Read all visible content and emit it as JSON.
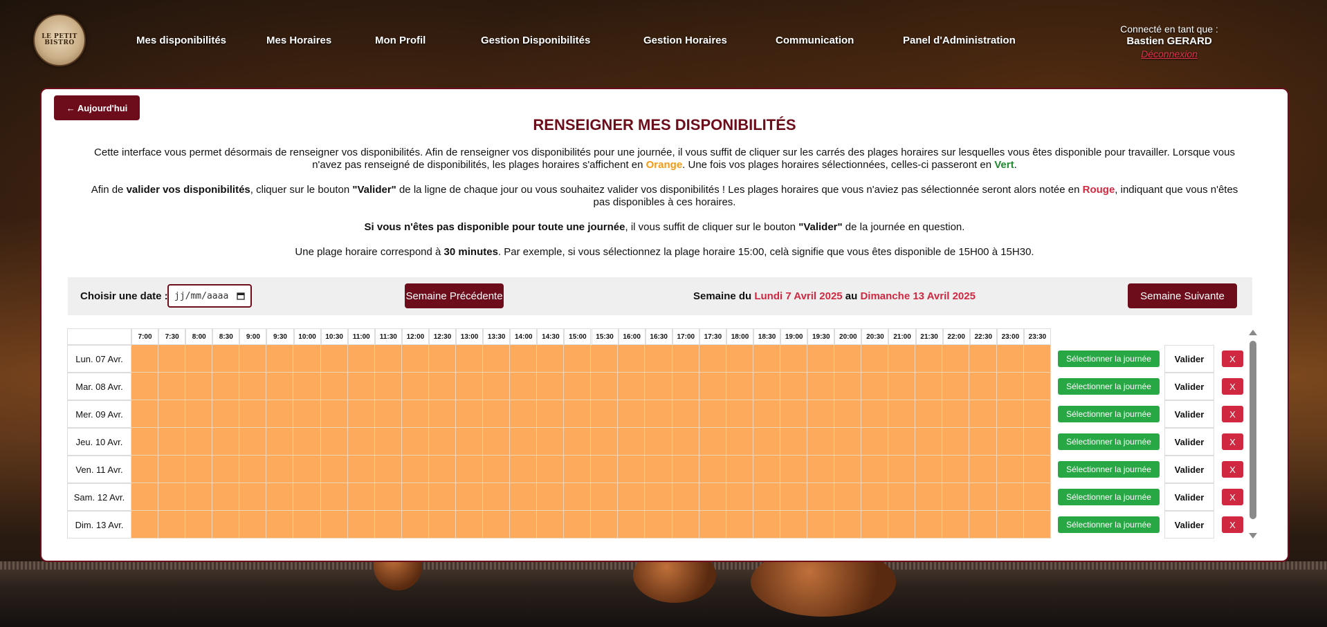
{
  "header": {
    "logo_text": "LE PETIT BISTRO",
    "nav": [
      {
        "label": "Mes disponibilités"
      },
      {
        "label": "Mes Horaires"
      },
      {
        "label": "Mon Profil"
      },
      {
        "label": "Gestion Disponibilités"
      },
      {
        "label": "Gestion Horaires"
      },
      {
        "label": "Communication"
      },
      {
        "label": "Panel d'Administration"
      }
    ],
    "user": {
      "connected_label": "Connecté en tant que :",
      "name": "Bastien GERARD",
      "logout": "Déconnexion"
    }
  },
  "main": {
    "today_button": "← Aujourd'hui",
    "title": "RENSEIGNER MES DISPONIBILITÉS",
    "para1": {
      "a": "Cette interface vous permet désormais de renseigner vos disponibilités. Afin de renseigner vos disponibilités pour une journée, il vous suffit de cliquer sur les carrés des plages horaires sur lesquelles vous êtes disponible pour travailler. Lorsque vous n'avez pas renseigné de disponibilités, les plages horaires s'affichent en ",
      "orange": "Orange",
      "b": ". Une fois vos plages horaires sélectionnées, celles-ci passeront en ",
      "green": "Vert",
      "c": "."
    },
    "para2": {
      "a": "Afin de ",
      "bold1": "valider vos disponibilités",
      "b": ", cliquer sur le bouton ",
      "bold2": "\"Valider\"",
      "c": " de la ligne de chaque jour ou vous souhaitez valider vos disponibilités ! Les plages horaires que vous n'aviez pas sélectionnée seront alors notée en ",
      "red": "Rouge",
      "d": ", indiquant que vous n'êtes pas disponibles à ces horaires."
    },
    "para3": {
      "bold1": "Si vous n'êtes pas disponible pour toute une journée",
      "a": ", il vous suffit de cliquer sur le bouton ",
      "bold2": "\"Valider\"",
      "b": " de la journée en question."
    },
    "para4": {
      "a": "Une plage horaire correspond à ",
      "bold1": "30 minutes",
      "b": ". Par exemple, si vous sélectionnez la plage horaire 15:00, celà signifie que vous êtes disponible de 15H00 à 15H30."
    },
    "week_nav": {
      "date_label": "Choisir une date :",
      "date_placeholder": "jj/mm/aaaa",
      "prev_button": "Semaine Précédente",
      "next_button": "Semaine Suivante",
      "week_prefix": "Semaine du ",
      "week_start": "Lundi 7 Avril 2025",
      "week_mid": " au ",
      "week_end": "Dimanche 13 Avril 2025"
    },
    "times": [
      "7:00",
      "7:30",
      "8:00",
      "8:30",
      "9:00",
      "9:30",
      "10:00",
      "10:30",
      "11:00",
      "11:30",
      "12:00",
      "12:30",
      "13:00",
      "13:30",
      "14:00",
      "14:30",
      "15:00",
      "15:30",
      "16:00",
      "16:30",
      "17:00",
      "17:30",
      "18:00",
      "18:30",
      "19:00",
      "19:30",
      "20:00",
      "20:30",
      "21:00",
      "21:30",
      "22:00",
      "22:30",
      "23:00",
      "23:30"
    ],
    "days": [
      {
        "label": "Lun. 07 Avr."
      },
      {
        "label": "Mar. 08 Avr."
      },
      {
        "label": "Mer. 09 Avr."
      },
      {
        "label": "Jeu. 10 Avr."
      },
      {
        "label": "Ven. 11 Avr."
      },
      {
        "label": "Sam. 12 Avr."
      },
      {
        "label": "Dim. 13 Avr."
      }
    ],
    "select_day_label": "Sélectionner la journée",
    "validate_label": "Valider",
    "cancel_label": "X",
    "colors": {
      "unset": "#fdaa5c",
      "brand": "#6d0d1c",
      "select": "#28a745",
      "cancel": "#d02840"
    }
  }
}
